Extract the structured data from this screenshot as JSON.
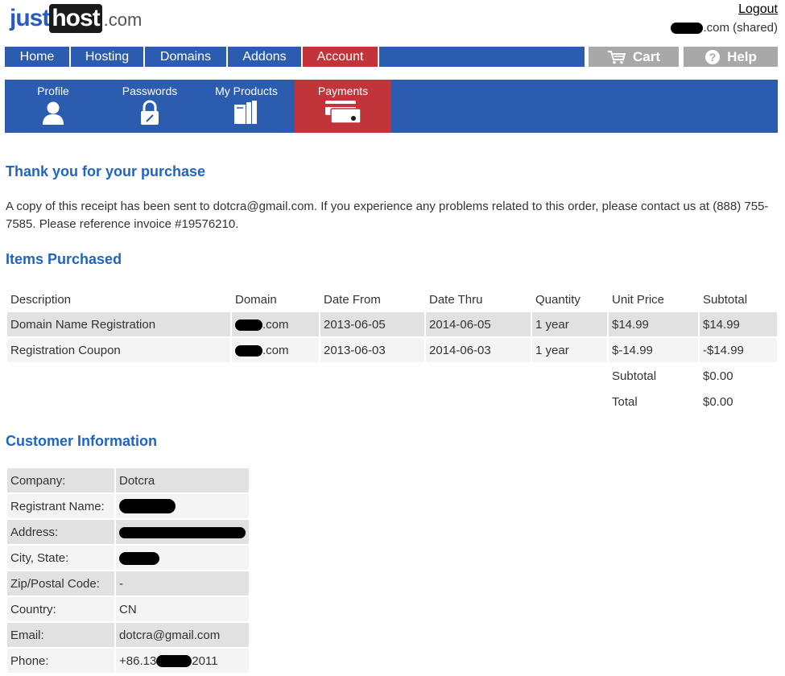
{
  "brand": {
    "part1": "just",
    "part2": "host",
    "part3": ".com"
  },
  "header": {
    "logout": "Logout",
    "account_domain_suffix": ".com (shared)"
  },
  "mainnav": [
    {
      "label": "Home",
      "active": false
    },
    {
      "label": "Hosting",
      "active": false
    },
    {
      "label": "Domains",
      "active": false
    },
    {
      "label": "Addons",
      "active": false
    },
    {
      "label": "Account",
      "active": true
    }
  ],
  "utility": {
    "cart": "Cart",
    "help": "Help"
  },
  "subnav": [
    {
      "label": "Profile",
      "icon": "user-icon",
      "active": false
    },
    {
      "label": "Passwords",
      "icon": "lock-icon",
      "active": false
    },
    {
      "label": "My Products",
      "icon": "products-icon",
      "active": false
    },
    {
      "label": "Payments",
      "icon": "credit-card-icon",
      "active": true
    }
  ],
  "receipt": {
    "title": "Thank you for your purchase",
    "note": "A copy of this receipt has been sent to dotcra@gmail.com. If you experience any problems related to this order, please contact us at (888) 755-7585. Please reference invoice #19576210."
  },
  "items": {
    "title": "Items Purchased",
    "columns": [
      "Description",
      "Domain",
      "Date From",
      "Date Thru",
      "Quantity",
      "Unit Price",
      "Subtotal"
    ],
    "rows": [
      {
        "description": "Domain Name Registration",
        "domain_suffix": ".com",
        "date_from": "2013-06-05",
        "date_thru": "2014-06-05",
        "quantity": "1 year",
        "unit_price": "$14.99",
        "subtotal": "$14.99"
      },
      {
        "description": "Registration Coupon",
        "domain_suffix": ".com",
        "date_from": "2013-06-03",
        "date_thru": "2014-06-03",
        "quantity": "1 year",
        "unit_price": "$-14.99",
        "subtotal": "-$14.99"
      }
    ],
    "totals": [
      {
        "label": "Subtotal",
        "value": "$0.00"
      },
      {
        "label": "Total",
        "value": "$0.00"
      }
    ]
  },
  "customer": {
    "title": "Customer Information",
    "rows": [
      {
        "label": "Company:",
        "value": "Dotcra"
      },
      {
        "label": "Registrant Name:",
        "value": ""
      },
      {
        "label": "Address:",
        "value": ""
      },
      {
        "label": "City, State:",
        "value": ""
      },
      {
        "label": "Zip/Postal Code:",
        "value": "-"
      },
      {
        "label": "Country:",
        "value": "CN"
      },
      {
        "label": "Email:",
        "value": "dotcra@gmail.com"
      },
      {
        "label": "Phone:",
        "value_prefix": "+86.13",
        "value_suffix": "2011"
      }
    ]
  },
  "colors": {
    "brand_blue": "#2b5cb0",
    "active_red": "#c0343a",
    "heading_blue": "#1f64c4",
    "utility_gray": "#a8a8a8"
  }
}
